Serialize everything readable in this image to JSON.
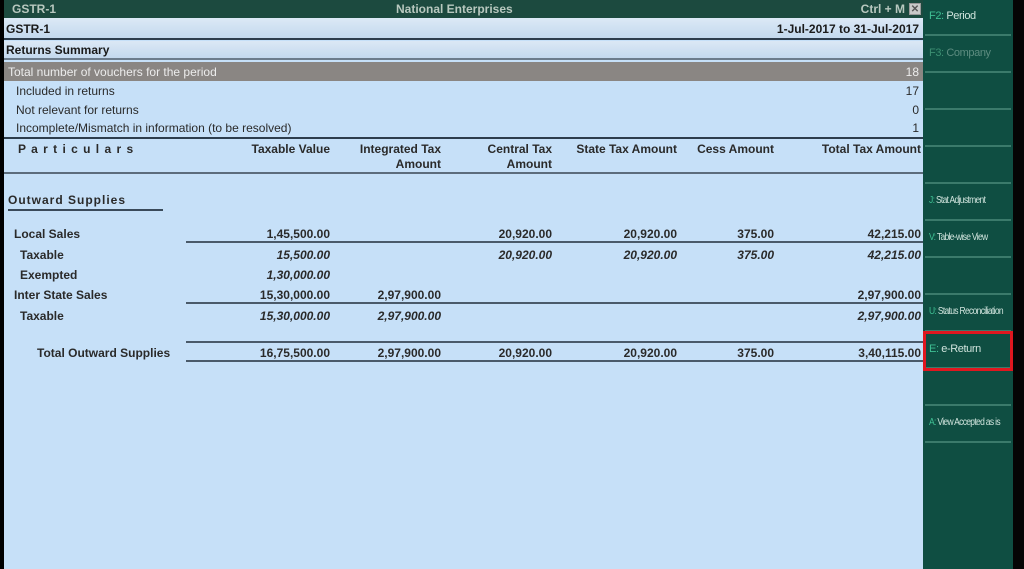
{
  "window": {
    "title_left": "GSTR-1",
    "title_center": "National Enterprises",
    "shortcut": "Ctrl + M",
    "close_glyph": "✕"
  },
  "report": {
    "name": "GSTR-1",
    "period": "1-Jul-2017 to 31-Jul-2017",
    "subtitle": "Returns Summary"
  },
  "vouchers": [
    {
      "label": "Total number of vouchers for the period",
      "value": "18"
    },
    {
      "label": "Included in returns",
      "value": "17"
    },
    {
      "label": "Not relevant for returns",
      "value": "0"
    },
    {
      "label": "Incomplete/Mismatch in information (to be resolved)",
      "value": "1"
    }
  ],
  "columns": {
    "particulars": "P a r t i c u l a r s",
    "taxable_value": "Taxable Value",
    "integrated_tax_1": "Integrated Tax",
    "integrated_tax_2": "Amount",
    "central_tax_1": "Central Tax",
    "central_tax_2": "Amount",
    "state_tax": "State Tax Amount",
    "cess": "Cess Amount",
    "total_tax": "Total Tax Amount"
  },
  "section_title": "Outward Supplies",
  "rows": [
    {
      "label": "Local Sales",
      "taxable": "1,45,500.00",
      "igst": "",
      "cgst": "20,920.00",
      "sgst": "20,920.00",
      "cess": "375.00",
      "total": "42,215.00"
    },
    {
      "label": "Taxable",
      "taxable": "15,500.00",
      "igst": "",
      "cgst": "20,920.00",
      "sgst": "20,920.00",
      "cess": "375.00",
      "total": "42,215.00"
    },
    {
      "label": "Exempted",
      "taxable": "1,30,000.00",
      "igst": "",
      "cgst": "",
      "sgst": "",
      "cess": "",
      "total": ""
    },
    {
      "label": "Inter State Sales",
      "taxable": "15,30,000.00",
      "igst": "2,97,900.00",
      "cgst": "",
      "sgst": "",
      "cess": "",
      "total": "2,97,900.00"
    },
    {
      "label": "Taxable",
      "taxable": "15,30,000.00",
      "igst": "2,97,900.00",
      "cgst": "",
      "sgst": "",
      "cess": "",
      "total": "2,97,900.00"
    },
    {
      "label": "Total Outward Supplies",
      "taxable": "16,75,500.00",
      "igst": "2,97,900.00",
      "cgst": "20,920.00",
      "sgst": "20,920.00",
      "cess": "375.00",
      "total": "3,40,115.00"
    }
  ],
  "sidebar": [
    {
      "key": "F2",
      "label": "Period",
      "enabled": true
    },
    {
      "key": "F3",
      "label": "Company",
      "enabled": false
    },
    {
      "key": "",
      "label": ""
    },
    {
      "key": "",
      "label": ""
    },
    {
      "key": "",
      "label": ""
    },
    {
      "key": "J",
      "label": "Stat Adjustment",
      "enabled": true
    },
    {
      "key": "V",
      "label": "Table-wise View",
      "enabled": true
    },
    {
      "key": "",
      "label": ""
    },
    {
      "key": "U",
      "label": "Status Reconciliation",
      "enabled": true
    },
    {
      "key": "E",
      "label": "e-Return",
      "enabled": true,
      "highlighted": true
    },
    {
      "key": "",
      "label": ""
    },
    {
      "key": "A",
      "label": "View Accepted as is",
      "enabled": true
    }
  ],
  "colors": {
    "title_bar": "#1c4a3f",
    "body_bg": "#c6e0f8",
    "highlight_row": "#8a8683",
    "sidebar_bg": "#0f4e42",
    "sidebar_key": "#3fbf93",
    "callout": "#e0171f"
  }
}
